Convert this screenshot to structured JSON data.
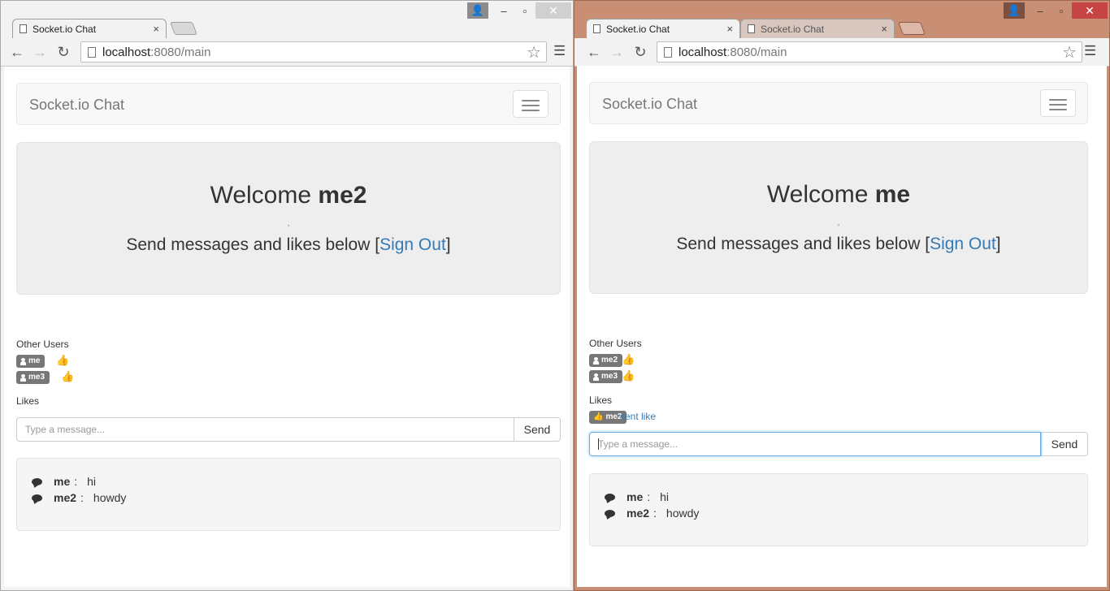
{
  "windows": [
    {
      "tabs": [
        {
          "title": "Socket.io Chat",
          "close": "×"
        }
      ],
      "address": {
        "host": "localhost",
        "path": ":8080/main"
      },
      "page": {
        "brand": "Socket.io Chat",
        "welcome_prefix": "Welcome ",
        "username": "me2",
        "dot": ",",
        "send_text": "Send messages and likes below [",
        "signout": "Sign Out",
        "send_text_end": "]",
        "other_users_label": "Other Users",
        "other_users": [
          "me",
          "me3"
        ],
        "likes_label": "Likes",
        "likes": [],
        "input_placeholder": "Type a message...",
        "send_button": "Send",
        "messages": [
          {
            "user": "me",
            "sep": ":",
            "text": "hi"
          },
          {
            "user": "me2",
            "sep": ":",
            "text": "howdy"
          }
        ]
      }
    },
    {
      "tabs": [
        {
          "title": "Socket.io Chat",
          "close": "×"
        },
        {
          "title": "Socket.io Chat",
          "close": "×"
        }
      ],
      "address": {
        "host": "localhost",
        "path": ":8080/main"
      },
      "page": {
        "brand": "Socket.io Chat",
        "welcome_prefix": "Welcome ",
        "username": "me",
        "dot": ",",
        "send_text": "Send messages and likes below [",
        "signout": "Sign Out",
        "send_text_end": "]",
        "other_users_label": "Other Users",
        "other_users": [
          "me2",
          "me3"
        ],
        "likes_label": "Likes",
        "likes": [
          {
            "user": "me2",
            "text": "sent like"
          }
        ],
        "input_placeholder": "Type a message...",
        "send_button": "Send",
        "messages": [
          {
            "user": "me",
            "sep": ":",
            "text": "hi"
          },
          {
            "user": "me2",
            "sep": ":",
            "text": "howdy"
          }
        ]
      }
    }
  ],
  "window_controls": {
    "minimize": "–",
    "maximize": "▫",
    "close": "✕"
  },
  "icons": {
    "back": "arrow-left",
    "forward": "arrow-right",
    "reload": "reload",
    "star": "star",
    "menu": "hamburger",
    "thumbs_up": "thumbs-up",
    "comment": "comment",
    "user": "user"
  },
  "colors": {
    "link": "#337ab7",
    "label_bg": "#777777",
    "right_frame": "#c98f74"
  }
}
